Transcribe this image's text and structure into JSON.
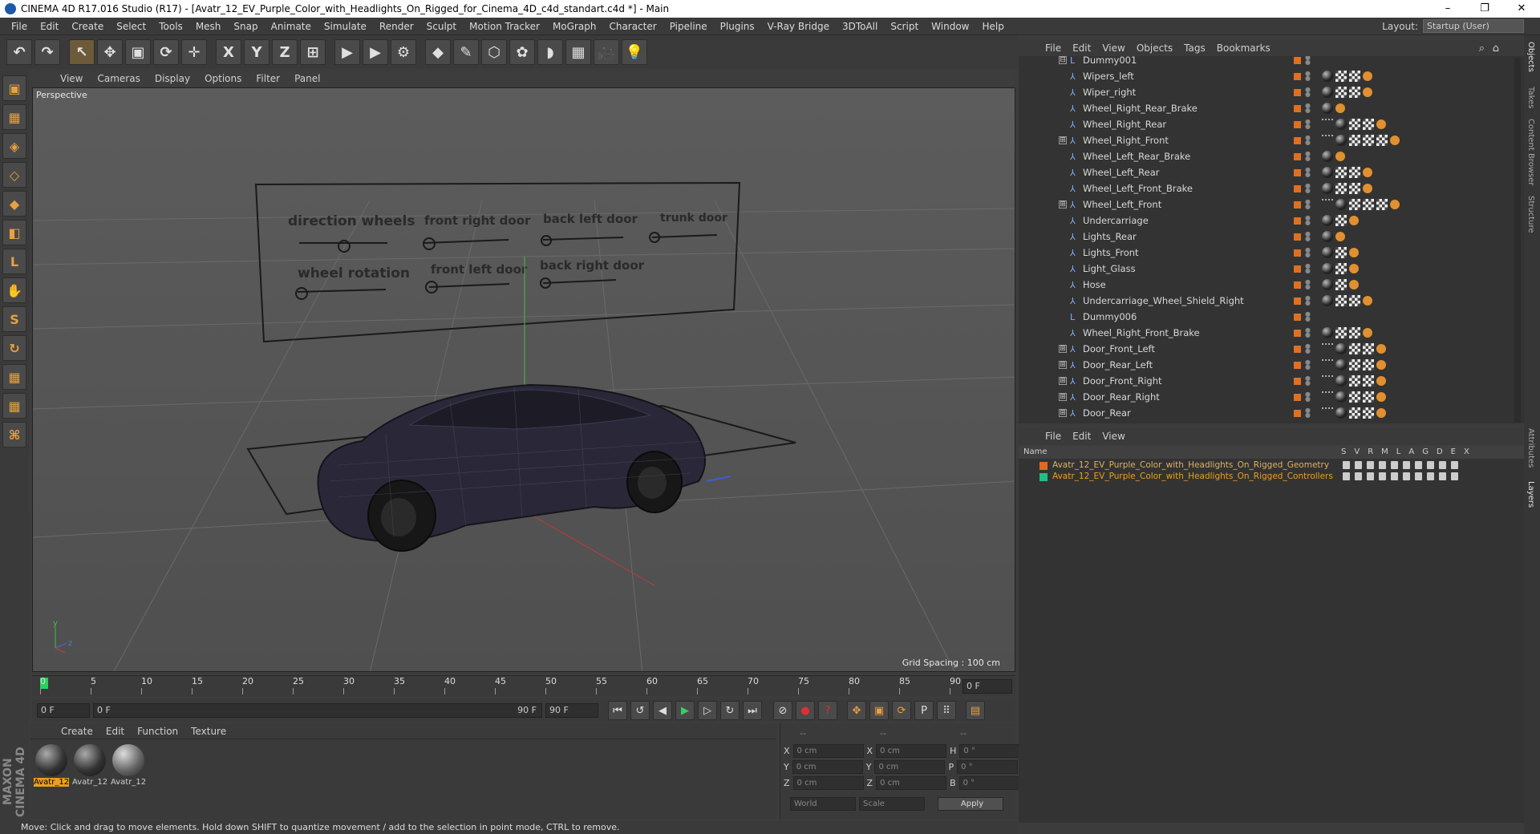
{
  "window": {
    "title": "CINEMA 4D R17.016 Studio (R17) - [Avatr_12_EV_Purple_Color_with_Headlights_On_Rigged_for_Cinema_4D_c4d_standart.c4d *] - Main",
    "min": "–",
    "max": "❐",
    "close": "✕"
  },
  "menu": [
    "File",
    "Edit",
    "Create",
    "Select",
    "Tools",
    "Mesh",
    "Snap",
    "Animate",
    "Simulate",
    "Render",
    "Sculpt",
    "Motion Tracker",
    "MoGraph",
    "Character",
    "Pipeline",
    "Plugins",
    "V-Ray Bridge",
    "3DToAll",
    "Script",
    "Window",
    "Help"
  ],
  "layout": {
    "label": "Layout:",
    "value": "Startup (User)"
  },
  "toolbar": {
    "undo": "↶",
    "redo": "↷",
    "select": "↖",
    "move": "✥",
    "scale": "▣",
    "rotate": "⟳",
    "live": "✛",
    "x": "X",
    "y": "Y",
    "z": "Z",
    "coord": "⊞",
    "render_view": "▶",
    "render_pv": "▶",
    "render_settings": "⚙",
    "cube": "◆",
    "pen": "✎",
    "subdiv": "⬡",
    "cloner": "✿",
    "deformer": "◗",
    "floor": "▦",
    "camera": "🎥",
    "light": "💡"
  },
  "lefttools": [
    "▣",
    "▦",
    "◈",
    "◇",
    "◆",
    "◧",
    "L",
    "✋",
    "S",
    "↻",
    "▦",
    "▦",
    "⌘"
  ],
  "viewport": {
    "menu": [
      "View",
      "Cameras",
      "Display",
      "Options",
      "Filter",
      "Panel"
    ],
    "label": "Perspective",
    "grid": "Grid Spacing : 100 cm",
    "controls": {
      "c1": "direction wheels",
      "c2": "front right door",
      "c3": "back left door",
      "c4": "trunk door",
      "c5": "wheel rotation",
      "c6": "front left door",
      "c7": "back right door"
    },
    "axis": {
      "y": "y",
      "z": "z"
    }
  },
  "timeline": {
    "ticks": [
      "0",
      "5",
      "10",
      "15",
      "20",
      "25",
      "30",
      "35",
      "40",
      "45",
      "50",
      "55",
      "60",
      "65",
      "70",
      "75",
      "80",
      "85",
      "90"
    ],
    "end": "0 F"
  },
  "playbar": {
    "start": "0 F",
    "range_start": "0 F",
    "range_end": "90 F",
    "end": "90 F"
  },
  "materials": {
    "menu": [
      "Create",
      "Edit",
      "Function",
      "Texture"
    ],
    "items": [
      "Avatr_12",
      "Avatr_12",
      "Avatr_12"
    ]
  },
  "coords": {
    "x": "X",
    "y": "Y",
    "z": "Z",
    "h": "H",
    "p": "P",
    "b": "B",
    "pos": "0 cm",
    "rot": "0 °",
    "dash": "--",
    "world": "World",
    "scale": "Scale",
    "apply": "Apply"
  },
  "status": "Move: Click and drag to move elements. Hold down SHIFT to quantize movement / add to the selection in point mode, CTRL to remove.",
  "maxon": "MAXON CINEMA 4D",
  "objects": {
    "menu": [
      "File",
      "Edit",
      "View",
      "Objects",
      "Tags",
      "Bookmarks"
    ],
    "rows": [
      {
        "name": "Dummy001",
        "exp": "⊟",
        "icon": "L"
      },
      {
        "name": "Wipers_left",
        "exp": "",
        "icon": "⅄"
      },
      {
        "name": "Wiper_right",
        "exp": "",
        "icon": "⅄"
      },
      {
        "name": "Wheel_Right_Rear_Brake",
        "exp": "",
        "icon": "⅄"
      },
      {
        "name": "Wheel_Right_Rear",
        "exp": "",
        "icon": "⅄"
      },
      {
        "name": "Wheel_Right_Front",
        "exp": "⊞",
        "icon": "⅄"
      },
      {
        "name": "Wheel_Left_Rear_Brake",
        "exp": "",
        "icon": "⅄"
      },
      {
        "name": "Wheel_Left_Rear",
        "exp": "",
        "icon": "⅄"
      },
      {
        "name": "Wheel_Left_Front_Brake",
        "exp": "",
        "icon": "⅄"
      },
      {
        "name": "Wheel_Left_Front",
        "exp": "⊞",
        "icon": "⅄"
      },
      {
        "name": "Undercarriage",
        "exp": "",
        "icon": "⅄"
      },
      {
        "name": "Lights_Rear",
        "exp": "",
        "icon": "⅄"
      },
      {
        "name": "Lights_Front",
        "exp": "",
        "icon": "⅄"
      },
      {
        "name": "Light_Glass",
        "exp": "",
        "icon": "⅄"
      },
      {
        "name": "Hose",
        "exp": "",
        "icon": "⅄"
      },
      {
        "name": "Undercarriage_Wheel_Shield_Right",
        "exp": "",
        "icon": "⅄"
      },
      {
        "name": "Dummy006",
        "exp": "",
        "icon": "L"
      },
      {
        "name": "Wheel_Right_Front_Brake",
        "exp": "",
        "icon": "⅄"
      },
      {
        "name": "Door_Front_Left",
        "exp": "⊞",
        "icon": "⅄"
      },
      {
        "name": "Door_Rear_Left",
        "exp": "⊞",
        "icon": "⅄"
      },
      {
        "name": "Door_Front_Right",
        "exp": "⊞",
        "icon": "⅄"
      },
      {
        "name": "Door_Rear_Right",
        "exp": "⊞",
        "icon": "⅄"
      },
      {
        "name": "Door_Rear",
        "exp": "⊞",
        "icon": "⅄"
      }
    ]
  },
  "layers": {
    "menu": [
      "File",
      "Edit",
      "View"
    ],
    "header_name": "Name",
    "cols": [
      "S",
      "V",
      "R",
      "M",
      "L",
      "A",
      "G",
      "D",
      "E",
      "X"
    ],
    "rows": [
      {
        "name": "Avatr_12_EV_Purple_Color_with_Headlights_On_Rigged_Geometry",
        "color": "#e06820",
        "text": "#e0b060"
      },
      {
        "name": "Avatr_12_EV_Purple_Color_with_Headlights_On_Rigged_Controllers",
        "color": "#20c080",
        "text": "#e8a020"
      }
    ]
  },
  "dock": [
    "Objects",
    "Takes",
    "Content Browser",
    "Structure",
    "Attributes",
    "Layers"
  ]
}
